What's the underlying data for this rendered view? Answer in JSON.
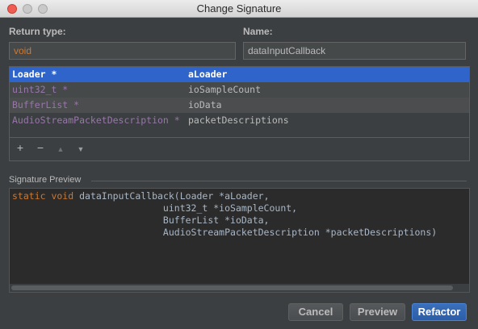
{
  "window": {
    "title": "Change Signature"
  },
  "return_type": {
    "label": "Return type:",
    "value": "void"
  },
  "name": {
    "label": "Name:",
    "value": "dataInputCallback"
  },
  "parameters": [
    {
      "type": "Loader *",
      "name": "aLoader"
    },
    {
      "type": "uint32_t *",
      "name": "ioSampleCount"
    },
    {
      "type": "BufferList *",
      "name": "ioData"
    },
    {
      "type": "AudioStreamPacketDescription *",
      "name": "packetDescriptions"
    }
  ],
  "table_buttons": {
    "add": "+",
    "remove": "−",
    "up": "▲",
    "down": "▼"
  },
  "preview": {
    "title": "Signature Preview",
    "keyword": "static void",
    "line1": " dataInputCallback(Loader *aLoader,",
    "line2": "                           uint32_t *ioSampleCount,",
    "line3": "                           BufferList *ioData,",
    "line4": "                           AudioStreamPacketDescription *packetDescriptions)"
  },
  "buttons": {
    "cancel": "Cancel",
    "preview": "Preview",
    "refactor": "Refactor"
  }
}
